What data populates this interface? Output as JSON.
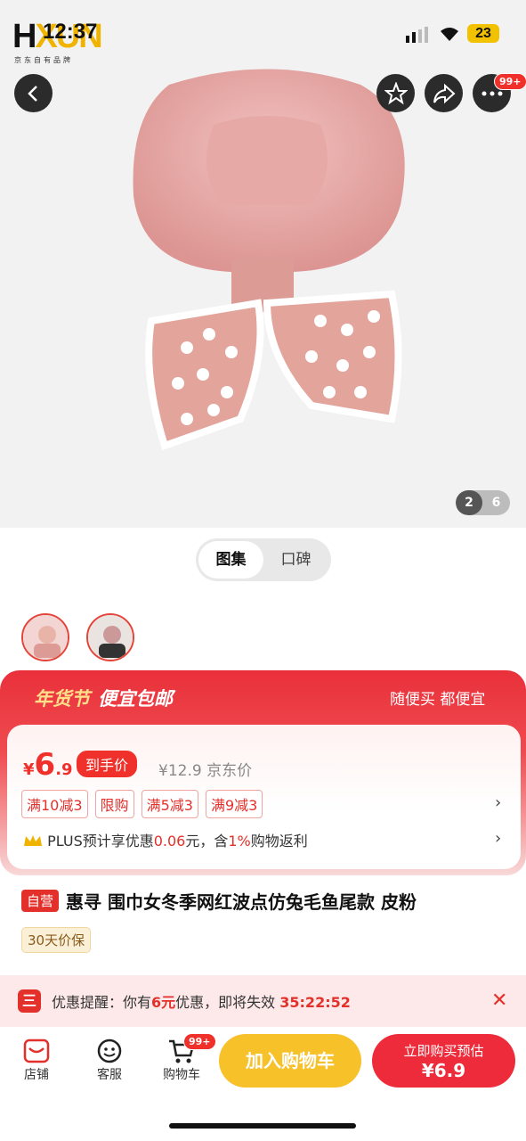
{
  "status_bar": {
    "time": "12:37",
    "battery": "23",
    "logo_text": "HXUN",
    "logo_sub": "京东自有品牌"
  },
  "header": {
    "badge": "99+"
  },
  "gallery": {
    "current": "2",
    "total": "6",
    "tabs": [
      {
        "label": "图集",
        "active": true
      },
      {
        "label": "口碑",
        "active": false
      }
    ]
  },
  "promo": {
    "left": "年货节",
    "middle": "便宜包邮",
    "right": "随便买 都便宜"
  },
  "price": {
    "currency": "¥",
    "integer": "6",
    "decimal": ".9",
    "tag": "到手价",
    "original": "¥12.9",
    "original_label": "京东价"
  },
  "coupons": [
    "满10减3",
    "限购",
    "满5减3",
    "满9减3"
  ],
  "plus": {
    "pre": "PLUS预计享优惠",
    "amount": "0.06",
    "mid": "元，含",
    "pct": "1%",
    "post": "购物返利"
  },
  "product": {
    "self_tag": "自营",
    "title": "惠寻 围巾女冬季网红波点仿兔毛鱼尾款 皮粉",
    "guarantee": "30天价保"
  },
  "reminder": {
    "icon": "三",
    "label": "优惠提醒：你有",
    "amount": "6元",
    "post": "优惠，即将失效",
    "countdown": "35:22:52"
  },
  "bottom": {
    "store": "店铺",
    "service": "客服",
    "cart": "购物车",
    "cart_badge": "99+",
    "add_cart": "加入购物车",
    "buy_line1": "立即购买预估",
    "buy_line2": "¥6.9"
  },
  "colors": {
    "accent": "#f0302b",
    "gold": "#f7c12a"
  }
}
